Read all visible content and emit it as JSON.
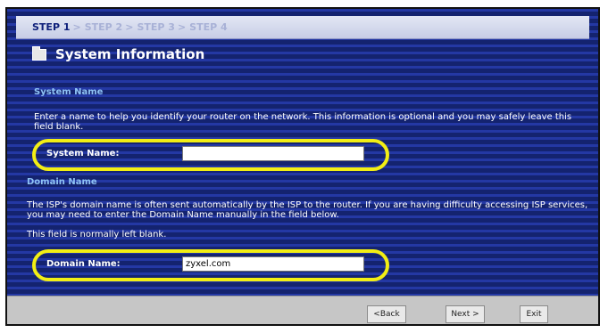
{
  "wizard": {
    "steps": [
      "STEP 1",
      "STEP 2",
      "STEP 3",
      "STEP 4"
    ],
    "step_separator": ">",
    "title": "System Information"
  },
  "system_name_section": {
    "heading": "System Name",
    "description": "Enter a name to help you identify your router on the network. This information is optional and you may safely leave this field blank.",
    "field_label": "System Name:",
    "field_value": ""
  },
  "domain_name_section": {
    "heading": "Domain Name",
    "description_1": "The ISP's domain name is often sent automatically by the ISP to the router. If you are having difficulty accessing ISP services, you may need to enter the Domain Name manually in the field below.",
    "description_2": "This field is normally left blank.",
    "field_label": "Domain Name:",
    "field_value": "zyxel.com"
  },
  "buttons": {
    "back": "<Back",
    "next": "Next >",
    "exit": "Exit"
  },
  "icons": {
    "title_icon": "folder-icon"
  },
  "colors": {
    "background": "#1a2a85",
    "section_heading": "#8fc3f5",
    "highlight": "#f2ee14",
    "bottom_bar": "#c6c6c6"
  }
}
